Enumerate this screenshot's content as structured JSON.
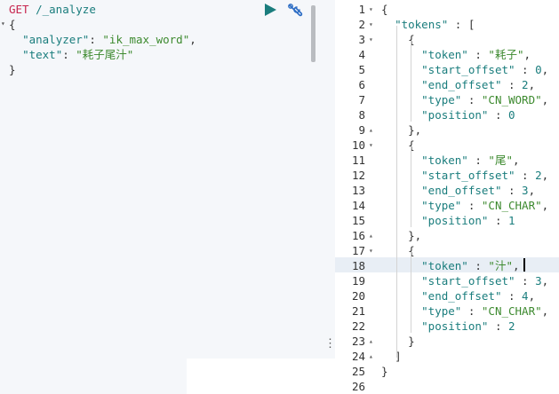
{
  "request": {
    "method": "GET",
    "path": "/_analyze",
    "lines": {
      "open": "{",
      "analyzer_key": "\"analyzer\"",
      "analyzer_value": "\"ik_max_word\"",
      "text_key": "\"text\"",
      "text_value": "\"耗子尾汁\"",
      "close": "}"
    }
  },
  "response": {
    "line_numbers": [
      "1",
      "2",
      "3",
      "4",
      "5",
      "6",
      "7",
      "8",
      "9",
      "10",
      "11",
      "12",
      "13",
      "14",
      "15",
      "16",
      "17",
      "18",
      "19",
      "20",
      "21",
      "22",
      "23",
      "24",
      "25",
      "26"
    ],
    "tokens_key": "\"tokens\"",
    "tokens": [
      {
        "token": "\"耗子\"",
        "start_offset": "0",
        "end_offset": "2",
        "type": "\"CN_WORD\"",
        "position": "0"
      },
      {
        "token": "\"尾\"",
        "start_offset": "2",
        "end_offset": "3",
        "type": "\"CN_CHAR\"",
        "position": "1"
      },
      {
        "token": "\"汁\"",
        "start_offset": "3",
        "end_offset": "4",
        "type": "\"CN_CHAR\"",
        "position": "2"
      }
    ]
  },
  "icons": {
    "run": "play-icon",
    "settings": "wrench-icon",
    "more": "vertical-dots-icon"
  },
  "colors": {
    "method": "#c7254e",
    "key": "#1a7d7d",
    "string": "#3d8a2f",
    "run": "#1a7d7d",
    "settings": "#2b6cc4",
    "active_line": "#e8eef5"
  }
}
